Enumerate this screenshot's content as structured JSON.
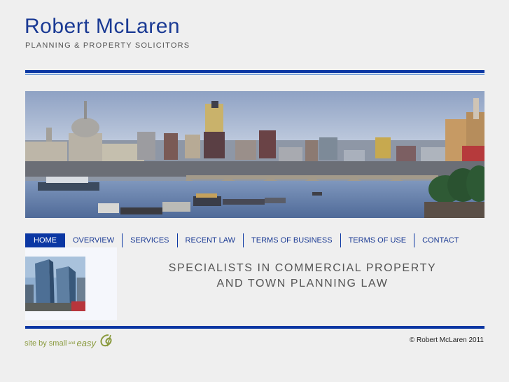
{
  "header": {
    "brand_name": "Robert McLaren",
    "tagline": "PLANNING & PROPERTY SOLICITORS"
  },
  "nav": {
    "items": [
      {
        "label": "HOME",
        "active": true
      },
      {
        "label": "OVERVIEW",
        "active": false
      },
      {
        "label": "SERVICES",
        "active": false
      },
      {
        "label": "RECENT LAW",
        "active": false
      },
      {
        "label": "TERMS OF BUSINESS",
        "active": false
      },
      {
        "label": "TERMS OF USE",
        "active": false
      },
      {
        "label": "CONTACT",
        "active": false
      }
    ]
  },
  "main": {
    "headline_line1": "SPECIALISTS IN COMMERCIAL PROPERTY",
    "headline_line2": "AND TOWN PLANNING LAW"
  },
  "footer": {
    "credit_prefix": "site by",
    "credit_small": "small",
    "credit_and": "and",
    "credit_easy": "easy",
    "copyright": "© Robert McLaren 2011"
  },
  "colors": {
    "brand_blue": "#0b37a3",
    "text_blue": "#1a3a94",
    "page_bg": "#efefef",
    "credit_green": "#8a9a3e"
  },
  "icons": {
    "banner": "london-skyline-image",
    "thumbnail": "office-towers-image",
    "logo": "small-and-easy-logo-icon"
  }
}
